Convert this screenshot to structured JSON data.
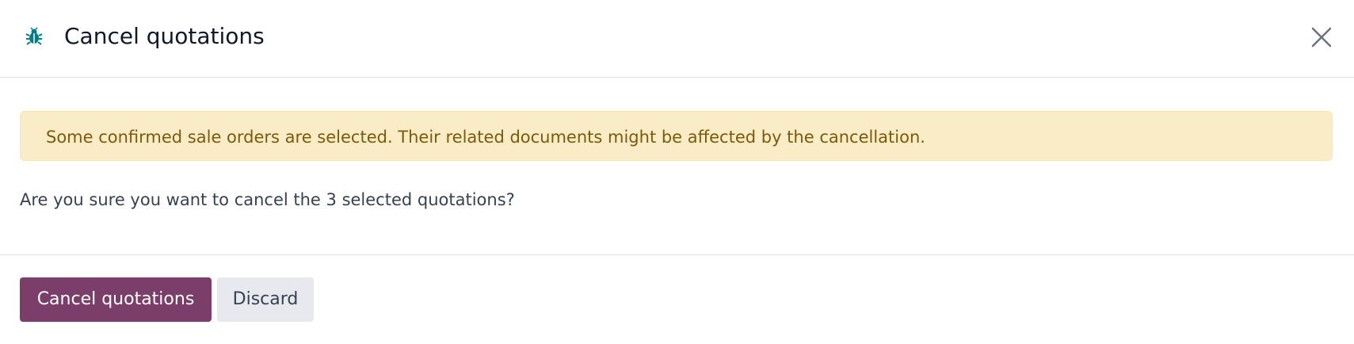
{
  "dialog": {
    "title": "Cancel quotations",
    "title_icon": "bug-icon",
    "close_icon": "close-icon"
  },
  "alert": {
    "text": "Some confirmed sale orders are selected. Their related documents might be affected by the cancellation."
  },
  "body": {
    "question": "Are you sure you want to cancel the 3 selected quotations?"
  },
  "footer": {
    "confirm_label": "Cancel quotations",
    "discard_label": "Discard"
  },
  "colors": {
    "primary": "#7b3e6b",
    "alert_bg": "#faecc7",
    "alert_text": "#7d5a08",
    "icon_teal": "#017e84"
  }
}
